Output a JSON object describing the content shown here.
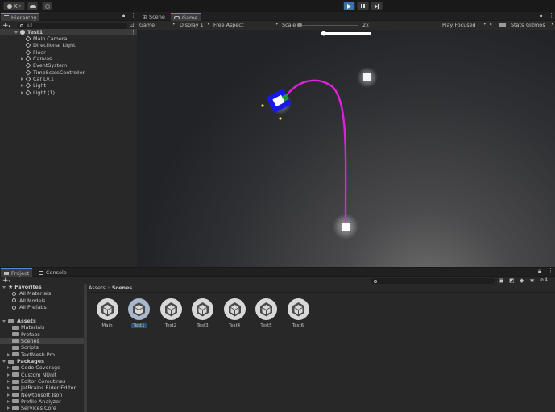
{
  "toolbar": {
    "account": "K",
    "play_state": "playing"
  },
  "hierarchy": {
    "tab_label": "Hierarchy",
    "search_placeholder": "All",
    "scene_name": "Test1",
    "items": [
      {
        "label": "Main Camera",
        "expandable": false
      },
      {
        "label": "Directional Light",
        "expandable": false
      },
      {
        "label": "Floor",
        "expandable": false
      },
      {
        "label": "Canvas",
        "expandable": true
      },
      {
        "label": "EventSystem",
        "expandable": false
      },
      {
        "label": "TimeScaleController",
        "expandable": false
      },
      {
        "label": "Car Lv.1",
        "expandable": true
      },
      {
        "label": "Light",
        "expandable": true
      },
      {
        "label": "Light (1)",
        "expandable": true
      }
    ]
  },
  "view_tabs": {
    "scene": "Scene",
    "game": "Game"
  },
  "game_bar": {
    "display_mode": "Game",
    "display": "Display 1",
    "aspect": "Free Aspect",
    "scale_label": "Scale",
    "scale_value": "2x",
    "play_mode": "Play Focused",
    "stats": "Stats",
    "gizmos": "Gizmos"
  },
  "game_view": {
    "path_color": "#e020e0",
    "car_color": "#1818e8",
    "slider_level": 1.0
  },
  "bottom_tabs": {
    "project": "Project",
    "console": "Console"
  },
  "project_toolbar": {
    "count": "4"
  },
  "favorites": {
    "title": "Favorites",
    "items": [
      "All Materials",
      "All Models",
      "All Prefabs"
    ]
  },
  "assets": {
    "title": "Assets",
    "items": [
      "Materials",
      "Prefabs",
      "Scenes",
      "Scripts",
      "TextMesh Pro"
    ],
    "selected": "Scenes"
  },
  "packages": {
    "title": "Packages",
    "items": [
      "Code Coverage",
      "Custom NUnit",
      "Editor Coroutines",
      "JetBrains Rider Editor",
      "Newtonsoft Json",
      "Profile Analyzer",
      "Services Core"
    ]
  },
  "breadcrumb": {
    "root": "Assets",
    "current": "Scenes"
  },
  "scenes": [
    {
      "label": "Main",
      "selected": false
    },
    {
      "label": "Test1",
      "selected": true
    },
    {
      "label": "Test2",
      "selected": false
    },
    {
      "label": "Test3",
      "selected": false
    },
    {
      "label": "Test4",
      "selected": false
    },
    {
      "label": "Test5",
      "selected": false
    },
    {
      "label": "Test6",
      "selected": false
    }
  ]
}
